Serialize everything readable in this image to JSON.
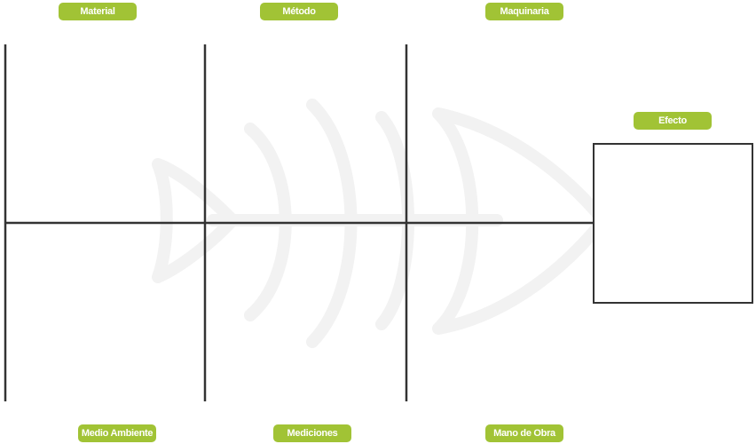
{
  "diagram": {
    "accent_color": "#a1c335",
    "line_color": "#333333",
    "watermark_color": "#f2f2f2",
    "watermark_icon": "fish-skeleton-icon",
    "categories": {
      "top": [
        "Material",
        "Método",
        "Maquinaria"
      ],
      "bottom": [
        "Medio Ambiente",
        "Mediciones",
        "Mano de Obra"
      ]
    },
    "effect_label": "Efecto"
  }
}
